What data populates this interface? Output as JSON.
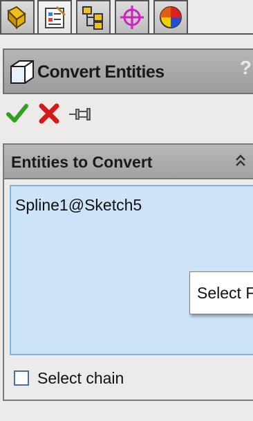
{
  "tabs": [
    {
      "name": "feature-manager",
      "icon": "feature-manager-icon",
      "active": false
    },
    {
      "name": "property-manager",
      "icon": "property-manager-icon",
      "active": true
    },
    {
      "name": "configuration-manager",
      "icon": "configuration-manager-icon",
      "active": false
    },
    {
      "name": "dimxpert-manager",
      "icon": "dimxpert-icon",
      "active": false
    },
    {
      "name": "display-manager",
      "icon": "display-manager-icon",
      "active": false
    }
  ],
  "header": {
    "title": "Convert Entities",
    "help": "?"
  },
  "actions": [
    {
      "icon": "ok-check-icon"
    },
    {
      "icon": "cancel-x-icon"
    },
    {
      "icon": "pushpin-icon"
    }
  ],
  "group": {
    "title": "Entities to Convert",
    "collapse_icon": "double-chevron-up-icon",
    "selected_entities": [
      "Spline1@Sketch5"
    ],
    "tooltip": "Select Fa",
    "select_chain_label": "Select chain",
    "select_chain_checked": false
  },
  "colors": {
    "listbox_bg": "#cde3f7",
    "listbox_border": "#7fb2de",
    "header_bg": "#a8a8a8"
  }
}
